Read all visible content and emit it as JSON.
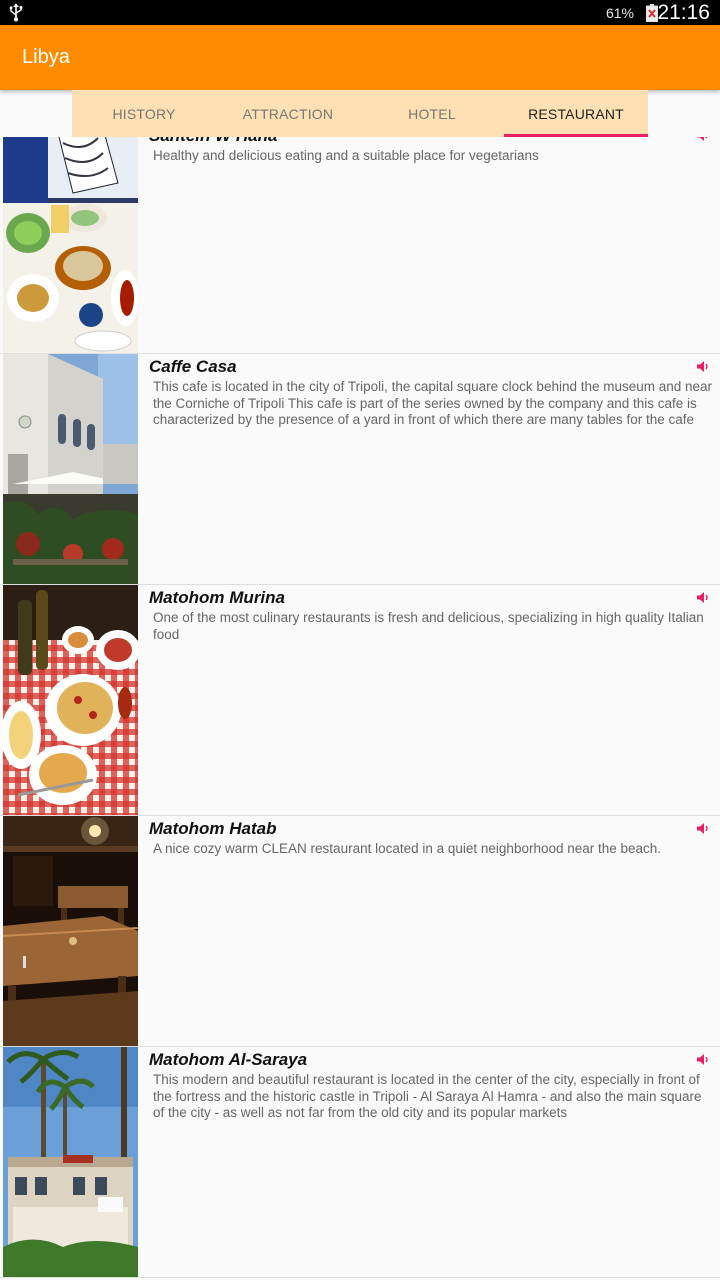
{
  "status_bar": {
    "battery": "61%",
    "time": "21:16"
  },
  "app_bar": {
    "title": "Libya"
  },
  "tabs": [
    {
      "label": "HISTORY"
    },
    {
      "label": "ATTRACTION"
    },
    {
      "label": "HOTEL"
    },
    {
      "label": "RESTAURANT"
    }
  ],
  "active_tab": "RESTAURANT",
  "restaurants": [
    {
      "name": "Sahtein W Hana",
      "description": "Healthy and delicious eating and a suitable place for vegetarians",
      "image": "mezze-dishes-photo"
    },
    {
      "name": "Caffe Casa",
      "description": "This cafe is located in the city of Tripoli, the capital square clock behind the museum and near the Corniche of Tripoli This cafe is part of the series owned by the company and this cafe is characterized by the presence of a yard in front of which there are many tables for the cafe",
      "image": "cafe-terrace-photo"
    },
    {
      "name": "Matohom Murina",
      "description": "One of the most culinary restaurants is fresh and delicious, specializing in high quality Italian food",
      "image": "pizza-table-photo"
    },
    {
      "name": "Matohom Hatab",
      "description": "A nice cozy warm CLEAN restaurant located in a quiet neighborhood near the beach.",
      "image": "wooden-interior-photo"
    },
    {
      "name": "Matohom Al-Saraya",
      "description": "This modern and beautiful restaurant is located in the center of the city, especially in front of the fortress and the historic castle in Tripoli - Al Saraya Al Hamra - and also the main square of the city - as well as not far from the old city and its popular markets",
      "image": "palm-building-photo"
    }
  ],
  "colors": {
    "app_bar": "#ff8c00",
    "tab_bar": "#ffe0b2",
    "indicator": "#e91e63",
    "sound_icon": "#e91e63"
  },
  "icons": {
    "usb": "usb-icon",
    "battery": "battery-icon",
    "sound": "speaker-icon"
  }
}
